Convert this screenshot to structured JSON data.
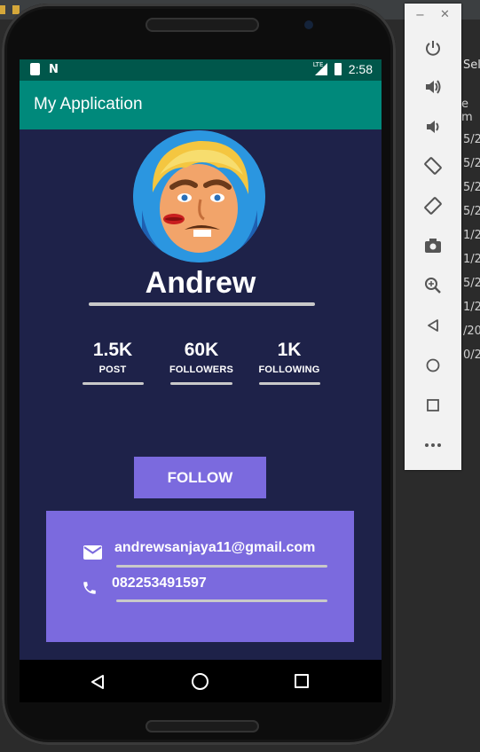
{
  "ide": {
    "tab_label": "Sel",
    "side_text": "e m",
    "dates": [
      "5/2",
      "5/2",
      "5/2",
      "5/2",
      "1/2",
      "1/2",
      "5/2",
      "1/2",
      "/20",
      "0/2"
    ]
  },
  "status_bar": {
    "network_label": "LTE",
    "time": "2:58"
  },
  "app_bar": {
    "title": "My Application"
  },
  "profile": {
    "name": "Andrew",
    "stats": [
      {
        "value": "1.5K",
        "label": "POST"
      },
      {
        "value": "60K",
        "label": "FOLLOWERS"
      },
      {
        "value": "1K",
        "label": "FOLLOWING"
      }
    ],
    "follow_label": "FOLLOW",
    "email": "andrewsanjaya11@gmail.com",
    "phone": "082253491597"
  },
  "colors": {
    "statusbar": "#00574b",
    "appbar": "#00897b",
    "screen_bg": "#1e2249",
    "accent": "#7b6ade"
  },
  "icons": {
    "email": "email-icon",
    "phone": "phone-icon",
    "power": "power-icon",
    "volume_up": "volume-up-icon",
    "volume_down": "volume-down-icon",
    "rotate_left": "rotate-left-icon",
    "rotate_right": "rotate-right-icon",
    "camera": "camera-icon",
    "zoom": "zoom-icon",
    "back": "back-icon",
    "home": "home-icon",
    "overview": "overview-icon",
    "more": "more-icon"
  }
}
